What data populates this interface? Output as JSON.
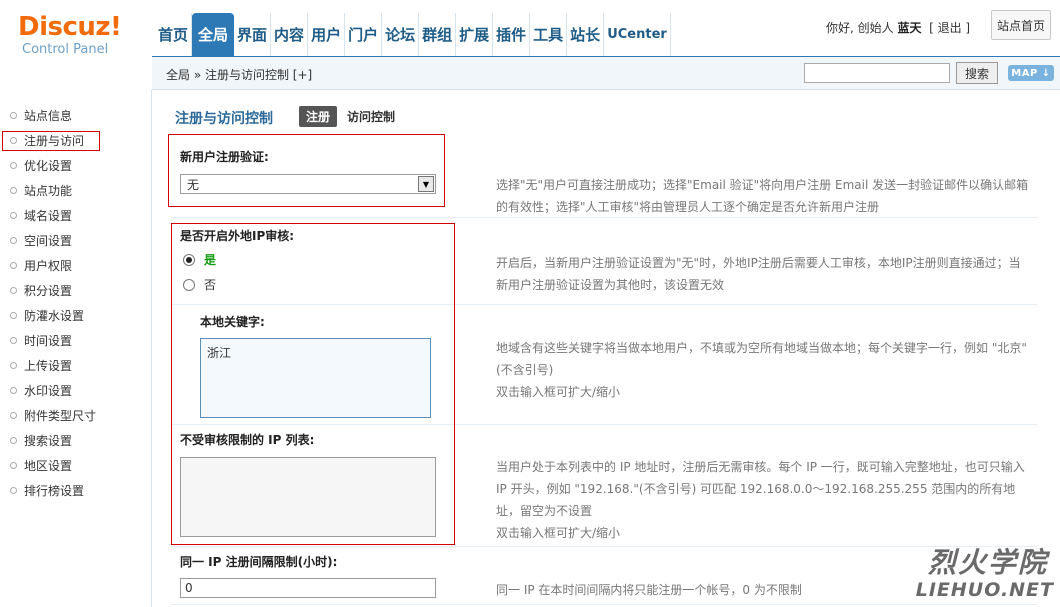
{
  "logo": {
    "brand": "Discuz!",
    "subtitle": "Control Panel"
  },
  "nav": {
    "items": [
      {
        "label": "首页"
      },
      {
        "label": "全局",
        "active": true
      },
      {
        "label": "界面"
      },
      {
        "label": "内容"
      },
      {
        "label": "用户"
      },
      {
        "label": "门户"
      },
      {
        "label": "论坛"
      },
      {
        "label": "群组"
      },
      {
        "label": "扩展"
      },
      {
        "label": "插件"
      },
      {
        "label": "工具"
      },
      {
        "label": "站长"
      },
      {
        "label": "UCenter"
      }
    ]
  },
  "user": {
    "greeting": "你好, 创始人",
    "name": "蓝天",
    "logout": "[ 退出 ]"
  },
  "site_home": "站点首页",
  "breadcrumb": "全局 » 注册与访问控制 [+]",
  "search": {
    "value": "",
    "button": "搜索"
  },
  "map_button": "MAP ↓",
  "sidebar": {
    "items": [
      {
        "label": "站点信息"
      },
      {
        "label": "注册与访问",
        "active": true
      },
      {
        "label": "优化设置"
      },
      {
        "label": "站点功能"
      },
      {
        "label": "域名设置"
      },
      {
        "label": "空间设置"
      },
      {
        "label": "用户权限"
      },
      {
        "label": "积分设置"
      },
      {
        "label": "防灌水设置"
      },
      {
        "label": "时间设置"
      },
      {
        "label": "上传设置"
      },
      {
        "label": "水印设置"
      },
      {
        "label": "附件类型尺寸"
      },
      {
        "label": "搜索设置"
      },
      {
        "label": "地区设置"
      },
      {
        "label": "排行榜设置"
      }
    ]
  },
  "page": {
    "title": "注册与访问控制",
    "tabs": [
      {
        "label": "注册",
        "active": true
      },
      {
        "label": "访问控制"
      }
    ]
  },
  "settings": {
    "verify": {
      "label": "新用户注册验证:",
      "value": "无",
      "desc_line1": "选择\"无\"用户可直接注册成功；选择\"Email 验证\"将向用户注册 Email 发送一封验证邮件以确认邮箱",
      "desc_line2": "的有效性；选择\"人工审核\"将由管理员人工逐个确定是否允许新用户注册"
    },
    "ip_audit": {
      "label": "是否开启外地IP审核:",
      "yes": "是",
      "no": "否",
      "desc_line1": "开启后，当新用户注册验证设置为\"无\"时，外地IP注册后需要人工审核，本地IP注册则直接通过；当",
      "desc_line2": "新用户注册验证设置为其他时，该设置无效"
    },
    "keywords": {
      "label": "本地关键字:",
      "value": "浙江",
      "desc_line1": "地域含有这些关键字将当做本地用户，不填或为空所有地域当做本地；每个关键字一行，例如 \"北京\"",
      "desc_line2": "(不含引号)",
      "desc_line3": "双击输入框可扩大/缩小"
    },
    "ip_whitelist": {
      "label": "不受审核限制的 IP 列表:",
      "value": "",
      "desc_line1": "当用户处于本列表中的 IP 地址时，注册后无需审核。每个 IP 一行，既可输入完整地址，也可只输入",
      "desc_line2": "IP 开头，例如 \"192.168.\"(不含引号) 可匹配 192.168.0.0～192.168.255.255 范围内的所有地",
      "desc_line3": "址，留空为不设置",
      "desc_line4": "双击输入框可扩大/缩小"
    },
    "interval": {
      "label": "同一 IP 注册间隔限制(小时):",
      "value": "0",
      "desc": "同一 IP 在本时间间隔内将只能注册一个帐号，0 为不限制"
    }
  },
  "watermark": {
    "cn": "烈火学院",
    "en": "LIEHUO.NET"
  },
  "colors": {
    "nav_active": "#2d79b6",
    "highlight_box": "#d40000",
    "logo": "#f26c0d",
    "radio_yes": "#159b15"
  }
}
